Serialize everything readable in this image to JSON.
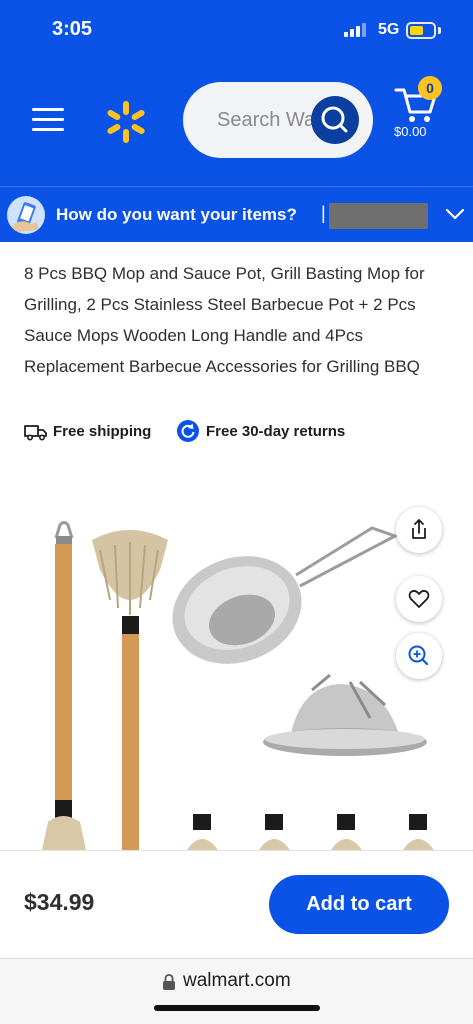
{
  "status_bar": {
    "time": "3:05",
    "network": "5G",
    "battery_color": "#ffd700"
  },
  "header": {
    "background": "#0b53e6",
    "menu_icon": "hamburger-menu-icon",
    "logo_icon": "walmart-spark-icon",
    "search": {
      "placeholder": "Search Walmart",
      "button_icon": "search-icon"
    },
    "cart": {
      "icon": "shopping-cart-icon",
      "count": "0",
      "total": "$0.00"
    }
  },
  "delivery_bar": {
    "icon": "delivery-phone-icon",
    "text": "How do you want your items?",
    "separator": "|",
    "chevron": "chevron-down-icon"
  },
  "product": {
    "title": "8 Pcs BBQ Mop and Sauce Pot, Grill Basting Mop for Grilling, 2 Pcs Stainless Steel Barbecue Pot + 2 Pcs Sauce Mops Wooden Long Handle and 4Pcs Replacement Barbecue Accessories for Grilling BBQ",
    "badges": [
      {
        "icon": "truck-icon",
        "label": "Free shipping"
      },
      {
        "icon": "return-arrow-icon",
        "label": "Free 30-day returns"
      }
    ],
    "image_actions": [
      {
        "icon": "share-icon"
      },
      {
        "icon": "heart-icon"
      },
      {
        "icon": "zoom-in-icon"
      }
    ]
  },
  "bottom_bar": {
    "price": "$34.99",
    "add_to_cart_label": "Add to cart",
    "button_color": "#0b53e6"
  },
  "browser": {
    "url": "walmart.com",
    "lock_icon": "lock-icon"
  }
}
